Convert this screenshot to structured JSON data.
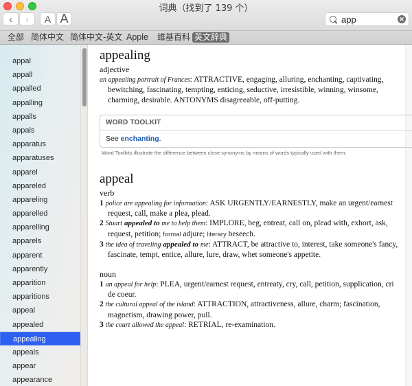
{
  "window": {
    "title": "词典（找到了 139 个）"
  },
  "toolbar": {
    "back_icon": "‹",
    "forward_icon": "›",
    "font_smaller_label": "A",
    "font_larger_label": "A",
    "search_value": "app",
    "search_clear_icon": "✕"
  },
  "tabs": [
    {
      "label": "全部",
      "active": false
    },
    {
      "label": "简体中文",
      "active": false
    },
    {
      "label": "简体中文-英文",
      "active": false
    },
    {
      "label": "Apple",
      "active": false
    },
    {
      "label": "维基百科",
      "active": false
    },
    {
      "label": "英文辞典",
      "active": true
    }
  ],
  "sidebar": {
    "items": [
      "appal",
      "appall",
      "appalled",
      "appalling",
      "appalls",
      "appals",
      "apparatus",
      "apparatuses",
      "apparel",
      "appareled",
      "appareling",
      "apparelled",
      "apparelling",
      "apparels",
      "apparent",
      "apparently",
      "apparition",
      "apparitions",
      "appeal",
      "appealed",
      "appealing",
      "appeals",
      "appear",
      "appearance"
    ],
    "selected": "appealing"
  },
  "entry1": {
    "headword": "appealing",
    "pos": "adjective",
    "example": "an appealing portrait of Frances",
    "definition": ": ATTRACTIVE, engaging, alluring, enchanting, captivating, bewitching, fascinating, tempting, enticing, seductive, irresistible, winning, winsome, charming, desirable. ANTONYMS disagreeable, off-putting."
  },
  "toolkit": {
    "heading": "WORD TOOLKIT",
    "see_label": "See",
    "link": "enchanting",
    "link_suffix": ".",
    "note": "Word Toolkits illustrate the difference between close synonyms by means of words typically used with them."
  },
  "entry2": {
    "headword": "appeal",
    "verb": {
      "pos": "verb",
      "senses": [
        {
          "num": "1",
          "ex": "police are appealing for information",
          "def": ": ASK URGENTLY/EARNESTLY, make an urgent/earnest request, call, make a plea, plead."
        },
        {
          "num": "2",
          "ex_pre": "Stuart",
          "ex_bold": "appealed to",
          "ex_post": "me to help them",
          "def": ": IMPLORE, beg, entreat, call on, plead with, exhort, ask, request, petition;",
          "reg1": "formal",
          "w1": "adjure;",
          "reg2": "literary",
          "w2": "beseech."
        },
        {
          "num": "3",
          "ex_pre": "the idea of traveling",
          "ex_bold": "appealed to",
          "ex_post": "me",
          "def": ": ATTRACT, be attractive to, interest, take someone's fancy, fascinate, tempt, entice, allure, lure, draw, whet someone's appetite."
        }
      ]
    },
    "noun": {
      "pos": "noun",
      "senses": [
        {
          "num": "1",
          "ex": "an appeal for help",
          "def": ": PLEA, urgent/earnest request, entreaty, cry, call, petition, supplication, cri de coeur."
        },
        {
          "num": "2",
          "ex": "the cultural appeal of the island",
          "def": ": ATTRACTION, attractiveness, allure, charm; fascination, magnetism, drawing power, pull."
        },
        {
          "num": "3",
          "ex": "the court allowed the appeal",
          "def": ": RETRIAL, re-examination."
        }
      ]
    }
  }
}
